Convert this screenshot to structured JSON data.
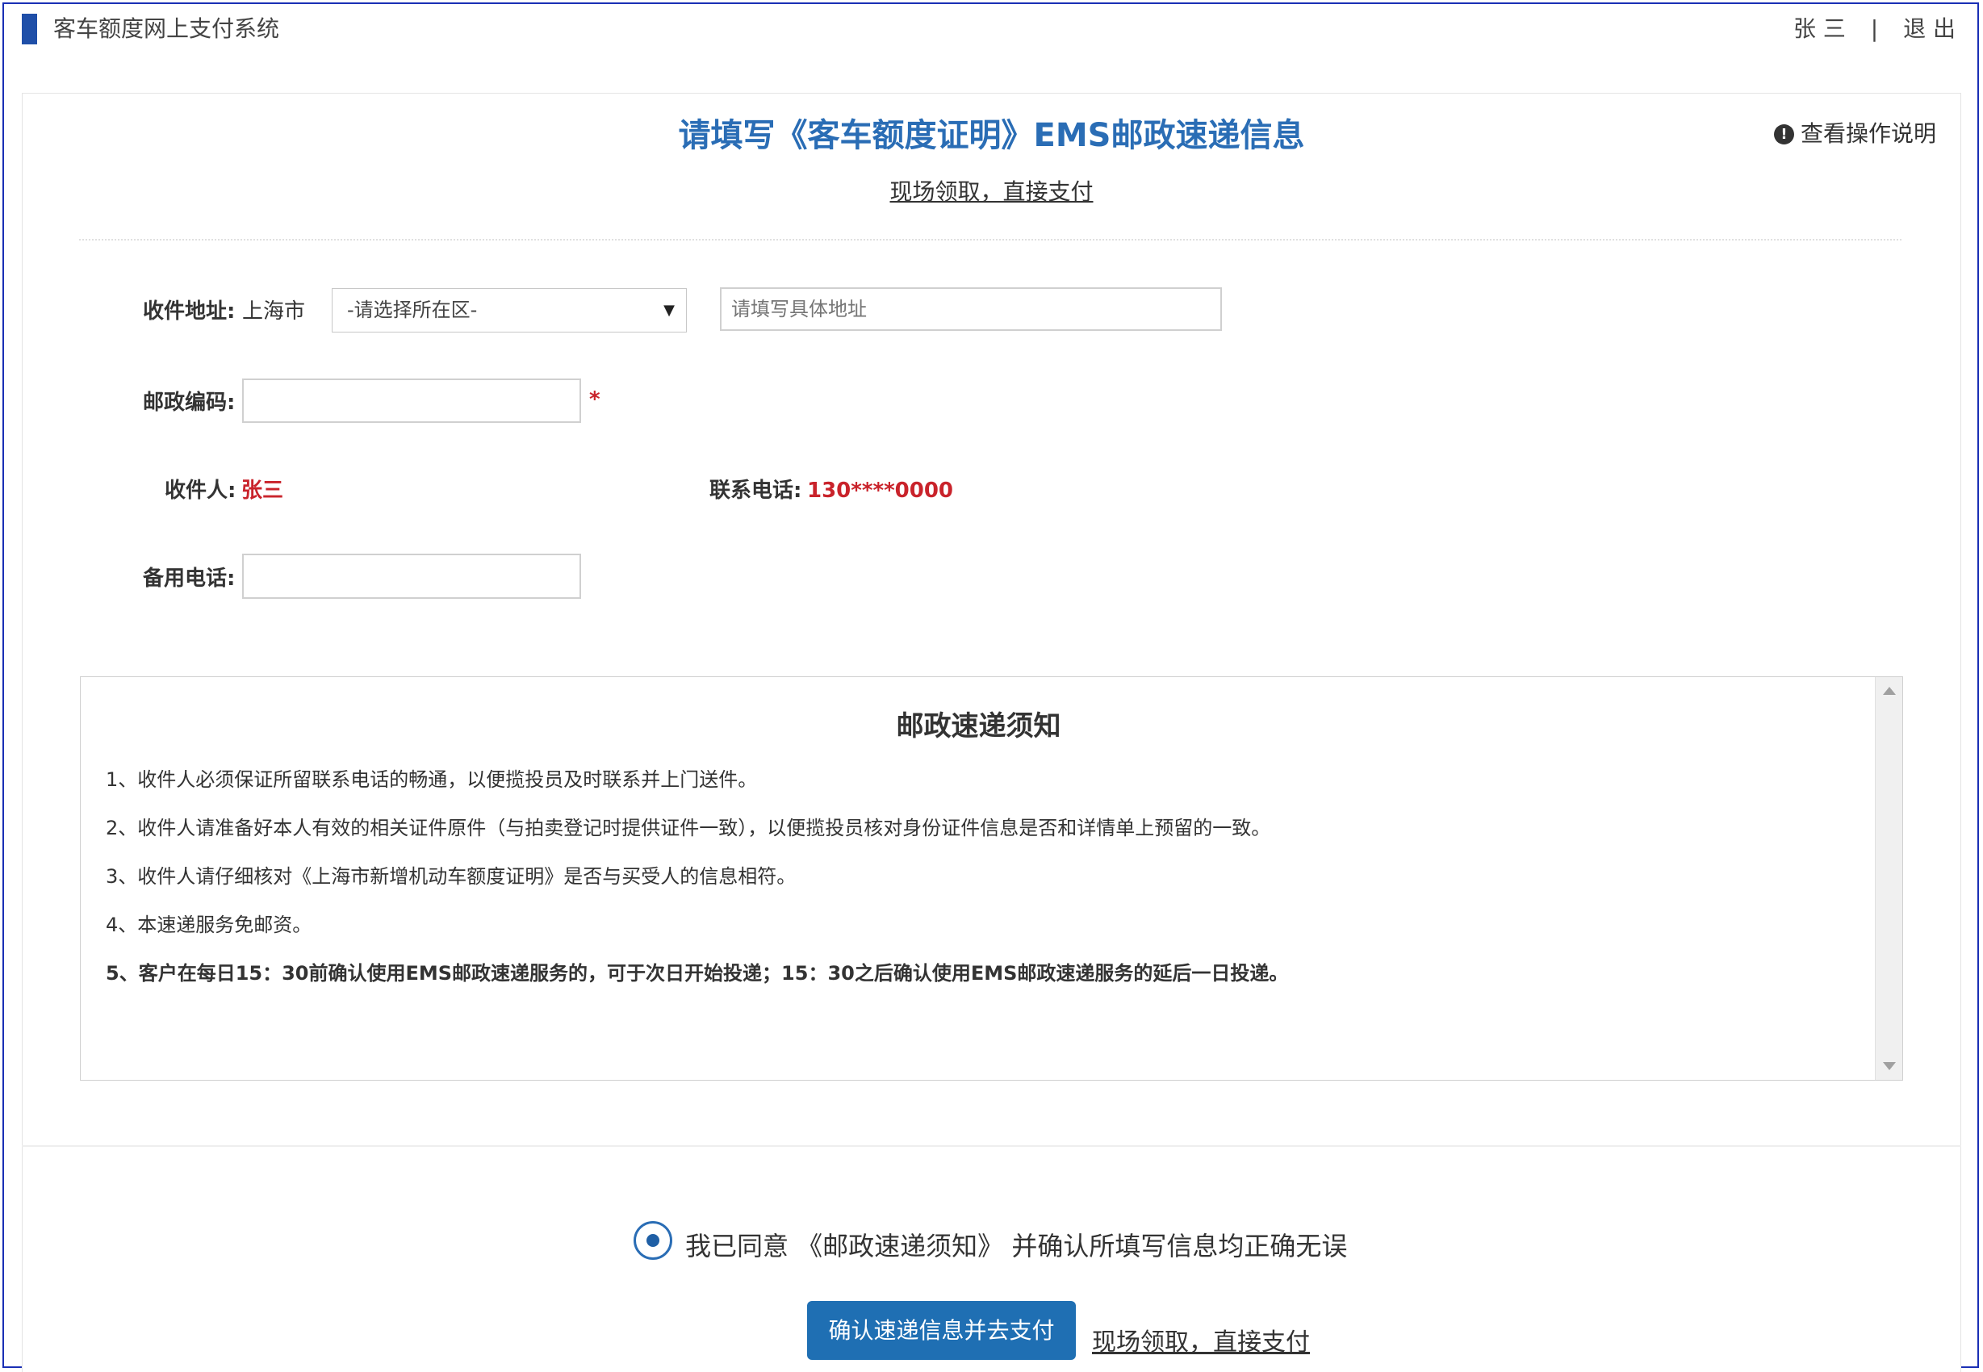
{
  "header": {
    "system_title": "客车额度网上支付系统",
    "user_name": "张 三",
    "separator": "|",
    "logout_label": "退 出"
  },
  "page": {
    "title": "请填写《客车额度证明》EMS邮政速递信息",
    "pickup_link": "现场领取，直接支付",
    "help_icon_glyph": "!",
    "help_label": "查看操作说明"
  },
  "form": {
    "address_label": "收件地址:",
    "city": "上海市",
    "district_select": "-请选择所在区-",
    "address_placeholder": "请填写具体地址",
    "postcode_label": "邮政编码:",
    "postcode_value": "",
    "required_mark": "*",
    "recipient_label": "收件人:",
    "recipient_value": "张三",
    "phone_label": "联系电话:",
    "phone_value": "130****0000",
    "backup_phone_label": "备用电话:",
    "backup_phone_value": ""
  },
  "notice": {
    "title": "邮政速递须知",
    "items": [
      "1、收件人必须保证所留联系电话的畅通，以便揽投员及时联系并上门送件。",
      "2、收件人请准备好本人有效的相关证件原件（与拍卖登记时提供证件一致），以便揽投员核对身份证件信息是否和详情单上预留的一致。",
      "3、收件人请仔细核对《上海市新增机动车额度证明》是否与买受人的信息相符。",
      "4、本速递服务免邮资。",
      "5、客户在每日15：30前确认使用EMS邮政速递服务的，可于次日开始投递；15：30之后确认使用EMS邮政速递服务的延后一日投递。"
    ]
  },
  "footer": {
    "agree_checked": true,
    "agree_text": "我已同意 《邮政速递须知》 并确认所填写信息均正确无误",
    "confirm_button": "确认速递信息并去支付",
    "pickup_link": "现场领取，直接支付"
  },
  "colors": {
    "accent": "#2a6db5",
    "button": "#1f6fb3",
    "required": "#c9232b",
    "frame": "#1a2fb5"
  }
}
